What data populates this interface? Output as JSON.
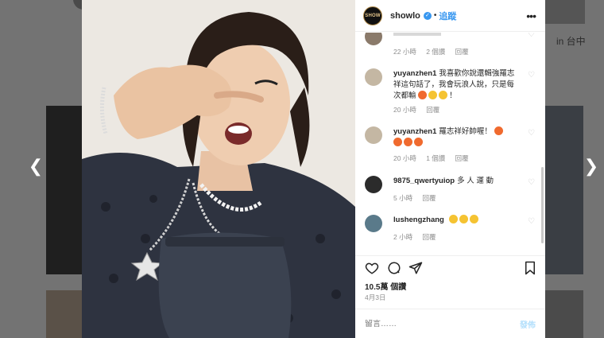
{
  "background": {
    "corner_text": "in 台中"
  },
  "post": {
    "username": "showlo",
    "verified_icon": "verified-badge-icon",
    "dot": "•",
    "follow_label": "追蹤",
    "more_icon": "•••",
    "avatar_logo_text": "SHOW"
  },
  "comments": [
    {
      "user": "",
      "text": "",
      "time": "22 小時",
      "replies": "2 個讚",
      "reply_label": "回覆"
    },
    {
      "user": "yuyanzhen1",
      "text": "我喜歡你說還輯強羅志祥這句話了，我會玩浪人說，只是每次都輸",
      "time": "20 小時",
      "replies": "",
      "reply_label": "回覆"
    },
    {
      "user": "yuyanzhen1",
      "text": "羅志祥好帥喔！",
      "time": "20 小時",
      "replies": "1 個讚",
      "reply_label": "回覆"
    },
    {
      "user": "9875_qwertyuiop",
      "text": "多 人 運 動",
      "time": "5 小時",
      "replies": "",
      "reply_label": "回覆"
    },
    {
      "user": "lushengzhang",
      "text": "",
      "time": "2 小時",
      "replies": "",
      "reply_label": "回覆"
    }
  ],
  "stats": {
    "likes": "10.5萬 個讚",
    "date": "4月3日"
  },
  "comment_input": {
    "placeholder": "留言……",
    "post_label": "發佈"
  },
  "colors": {
    "accent": "#3897f0",
    "post_btn_disabled": "#b2dffc",
    "meta": "#8e8e8e"
  }
}
